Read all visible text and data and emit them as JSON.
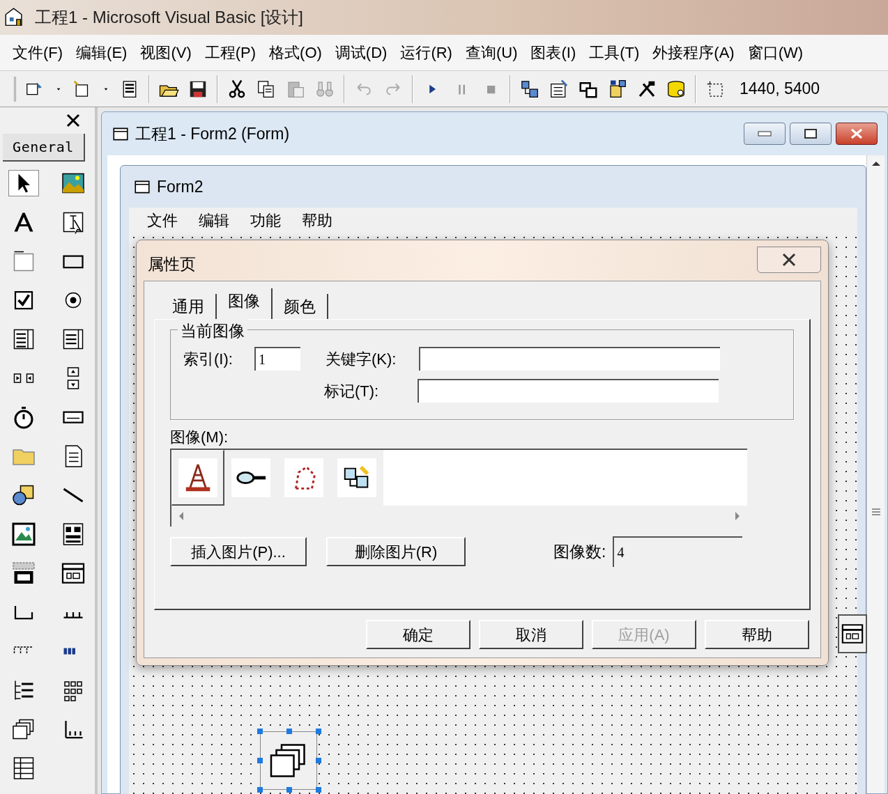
{
  "window": {
    "title": "工程1 - Microsoft Visual Basic [设计]"
  },
  "menu": [
    "文件(F)",
    "编辑(E)",
    "视图(V)",
    "工程(P)",
    "格式(O)",
    "调试(D)",
    "运行(R)",
    "查询(U)",
    "图表(I)",
    "工具(T)",
    "外接程序(A)",
    "窗口(W)"
  ],
  "toolbar": {
    "position": "1440, 5400"
  },
  "toolbox": {
    "tab": "General"
  },
  "child_window": {
    "title": "工程1 - Form2 (Form)"
  },
  "form": {
    "title": "Form2",
    "menu": [
      "文件",
      "编辑",
      "功能",
      "帮助"
    ]
  },
  "dialog": {
    "title": "属性页",
    "tabs": [
      {
        "label": "通用",
        "selected": false
      },
      {
        "label": "图像",
        "selected": true
      },
      {
        "label": "颜色",
        "selected": false
      }
    ],
    "group": "当前图像",
    "index": {
      "label": "索引(I):",
      "value": "1"
    },
    "key": {
      "label": "关键字(K):"
    },
    "tag": {
      "label": "标记(T):"
    },
    "images_label": "图像(M):",
    "images": [
      {
        "selected": true
      },
      {
        "selected": false
      },
      {
        "selected": false
      },
      {
        "selected": false
      }
    ],
    "insert_button": "插入图片(P)...",
    "remove_button": "删除图片(R)",
    "count": {
      "label": "图像数:",
      "value": "4"
    },
    "buttons": [
      {
        "label": "确定",
        "disabled": false
      },
      {
        "label": "取消",
        "disabled": false
      },
      {
        "label": "应用(A)",
        "disabled": true
      },
      {
        "label": "帮助",
        "disabled": false
      }
    ]
  }
}
